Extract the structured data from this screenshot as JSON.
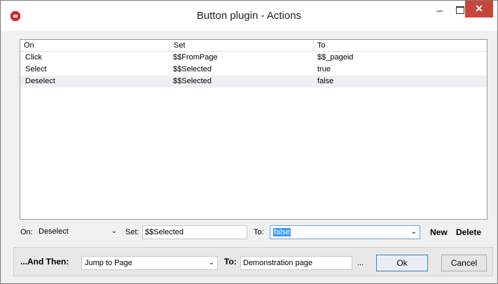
{
  "window": {
    "title": "Button plugin - Actions",
    "controls": {
      "minimize": "–",
      "close": "✕"
    },
    "accent_close": "#c7463b",
    "app_icon_color": "#d8252b"
  },
  "grid": {
    "columns": [
      "On",
      "Set",
      "To"
    ],
    "rows": [
      {
        "on": "Click",
        "set": "$$FromPage",
        "to": "$$_pageid"
      },
      {
        "on": "Select",
        "set": "$$Selected",
        "to": "true"
      },
      {
        "on": "Deselect",
        "set": "$$Selected",
        "to": "false"
      }
    ],
    "selected_row": 2
  },
  "editor": {
    "on_label": "On:",
    "on_value": "Deselect",
    "set_label": "Set:",
    "set_value": "$$Selected",
    "to_label": "To:",
    "to_value": "false",
    "new_label": "New",
    "delete_label": "Delete"
  },
  "footer": {
    "and_then_label": "...And Then:",
    "and_then_value": "Jump to Page",
    "to_label": "To:",
    "to_value": "Demonstration page",
    "browse_label": "...",
    "ok_label": "Ok",
    "cancel_label": "Cancel"
  }
}
